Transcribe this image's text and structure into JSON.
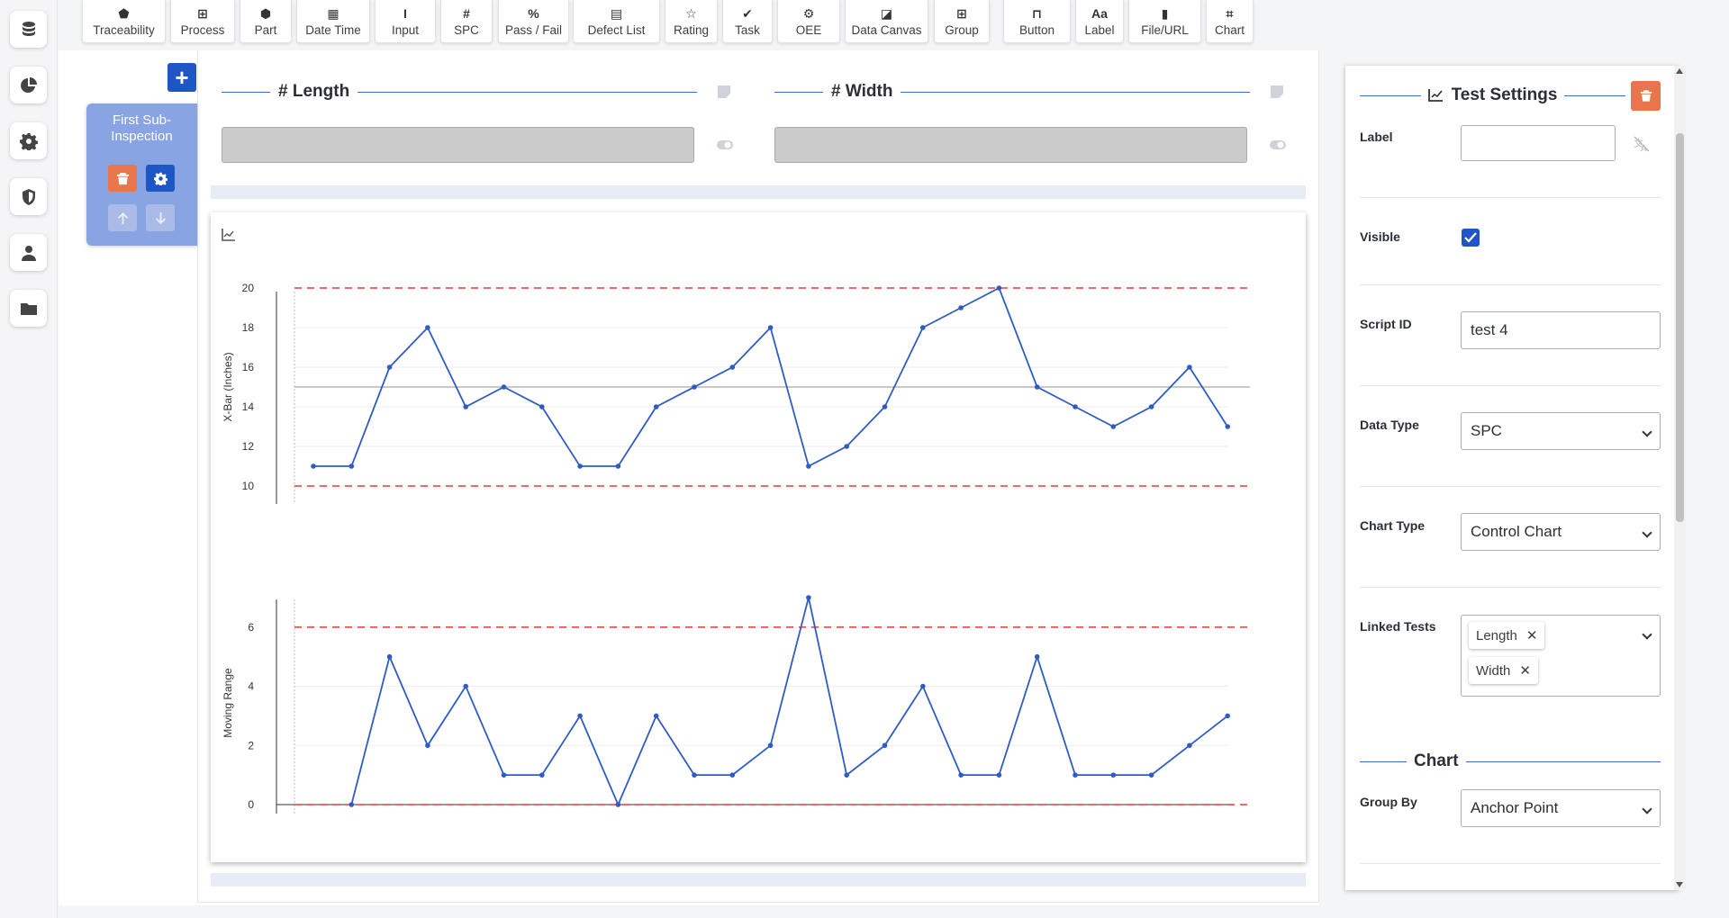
{
  "nav": {
    "icons": [
      "database-icon",
      "chart-pie-icon",
      "gear-icon",
      "shield-icon",
      "user-icon",
      "folder-icon"
    ]
  },
  "toolbar": {
    "items": [
      {
        "label": "Traceability",
        "icon": "tag-icon"
      },
      {
        "label": "Process",
        "icon": "process-icon"
      },
      {
        "label": "Part",
        "icon": "part-icon"
      },
      {
        "label": "Date Time",
        "icon": "calendar-icon"
      },
      {
        "label": "Input",
        "icon": "text-cursor-icon"
      },
      {
        "label": "SPC",
        "icon": "hash-icon"
      },
      {
        "label": "Pass / Fail",
        "icon": "percent-icon"
      },
      {
        "label": "Defect List",
        "icon": "list-icon"
      },
      {
        "label": "Rating",
        "icon": "star-icon"
      },
      {
        "label": "Task",
        "icon": "clipboard-check-icon"
      },
      {
        "label": "OEE",
        "icon": "oee-icon"
      },
      {
        "label": "Data Canvas",
        "icon": "canvas-icon"
      },
      {
        "label": "Group",
        "icon": "grid-icon"
      },
      {
        "label": "Button",
        "icon": "button-icon"
      },
      {
        "label": "Label",
        "icon": "font-icon"
      },
      {
        "label": "File/URL",
        "icon": "file-icon"
      },
      {
        "label": "Chart",
        "icon": "chart-line-icon"
      }
    ],
    "glyphs": [
      "⬟",
      "⊞",
      "⬢",
      "▦",
      "I",
      "#",
      "%",
      "▤",
      "☆",
      "✔",
      "⚙",
      "◪",
      "⊞",
      "⊓",
      "Aa",
      "▮",
      "⌗"
    ]
  },
  "canvas": {
    "add_label": "+",
    "sub_inspection": {
      "title": "First Sub-Inspection"
    },
    "tests": [
      {
        "symbol": "#",
        "name": "Length"
      },
      {
        "symbol": "#",
        "name": "Width"
      }
    ]
  },
  "chart_data": [
    {
      "type": "line",
      "title": "",
      "ylabel": "X-Bar (Inches)",
      "xlabel": "",
      "ylim": [
        10,
        20
      ],
      "yticks": [
        10,
        12,
        14,
        16,
        18,
        20
      ],
      "center_line": 15,
      "ucl": 20,
      "lcl": 10,
      "grid": true,
      "series": [
        {
          "values": [
            11,
            11,
            16,
            18,
            14,
            15,
            14,
            11,
            11,
            14,
            15,
            16,
            18,
            11,
            12,
            14,
            18,
            19,
            20,
            15,
            14,
            13,
            14,
            16,
            13
          ]
        }
      ]
    },
    {
      "type": "line",
      "title": "",
      "ylabel": "Moving Range",
      "xlabel": "",
      "ylim": [
        0,
        7
      ],
      "yticks": [
        0,
        2,
        4,
        6
      ],
      "ucl": 6,
      "lcl": 0,
      "grid": true,
      "series": [
        {
          "values": [
            0,
            5,
            2,
            4,
            1,
            1,
            3,
            0,
            3,
            1,
            1,
            2,
            7,
            1,
            2,
            4,
            1,
            1,
            5,
            1,
            1,
            1,
            2,
            3
          ]
        }
      ]
    }
  ],
  "settings": {
    "title": "Test Settings",
    "label_field": {
      "label": "Label",
      "value": ""
    },
    "visible": {
      "label": "Visible",
      "checked": true
    },
    "script_id": {
      "label": "Script ID",
      "value": "test 4"
    },
    "data_type": {
      "label": "Data Type",
      "value": "SPC"
    },
    "chart_type": {
      "label": "Chart Type",
      "value": "Control Chart"
    },
    "linked_tests": {
      "label": "Linked Tests",
      "chips": [
        "Length",
        "Width"
      ]
    },
    "chart_section": {
      "title": "Chart"
    },
    "group_by": {
      "label": "Group By",
      "value": "Anchor Point"
    }
  },
  "colors": {
    "accent": "#1f56c6",
    "danger": "#e8764a",
    "line": "#2f5cc4",
    "limit": "#e53935"
  }
}
